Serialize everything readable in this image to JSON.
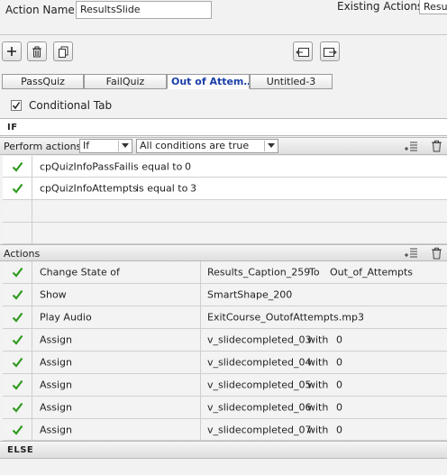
{
  "header": {
    "action_name_label": "Action Name:",
    "action_name_value": "ResultsSlide",
    "existing_actions_label": "Existing Actions:",
    "existing_actions_value": "Resu"
  },
  "toolbar": {
    "add_icon": "plus-icon",
    "delete_icon": "trash-icon",
    "duplicate_icon": "copy-icon",
    "import_icon": "import-icon",
    "export_icon": "export-icon"
  },
  "tabs": [
    {
      "label": "PassQuiz",
      "active": false
    },
    {
      "label": "FailQuiz",
      "active": false
    },
    {
      "label": "Out of Attem…",
      "active": true
    },
    {
      "label": "Untitled-3",
      "active": false
    }
  ],
  "conditional": {
    "label": "Conditional Tab",
    "checked": true
  },
  "if_section": {
    "title": "IF",
    "perform_label": "Perform actions:",
    "perform_value": "If",
    "conditions_value": "All conditions are true",
    "conditions": [
      {
        "variable": "cpQuizInfoPassFail",
        "operator": "is equal to",
        "value": "0"
      },
      {
        "variable": "cpQuizInfoAttempts",
        "operator": "is equal to",
        "value": "3"
      }
    ]
  },
  "actions_section": {
    "title": "Actions",
    "rows": [
      {
        "action": "Change State of",
        "target": "Results_Caption_259",
        "mid": "To",
        "value": "Out_of_Attempts"
      },
      {
        "action": "Show",
        "target": "SmartShape_200",
        "mid": "",
        "value": ""
      },
      {
        "action": "Play Audio",
        "target": "ExitCourse_OutofAttempts.mp3",
        "mid": "",
        "value": ""
      },
      {
        "action": "Assign",
        "target": "v_slidecompleted_03",
        "mid": "with",
        "value": "0"
      },
      {
        "action": "Assign",
        "target": "v_slidecompleted_04",
        "mid": "with",
        "value": "0"
      },
      {
        "action": "Assign",
        "target": "v_slidecompleted_05",
        "mid": "with",
        "value": "0"
      },
      {
        "action": "Assign",
        "target": "v_slidecompleted_06",
        "mid": "with",
        "value": "0"
      },
      {
        "action": "Assign",
        "target": "v_slidecompleted_07",
        "mid": "with",
        "value": "0"
      }
    ]
  },
  "else_section": {
    "title": "ELSE"
  },
  "colors": {
    "check_green": "#2f9a1f",
    "active_tab_text": "#1a3ea8"
  }
}
